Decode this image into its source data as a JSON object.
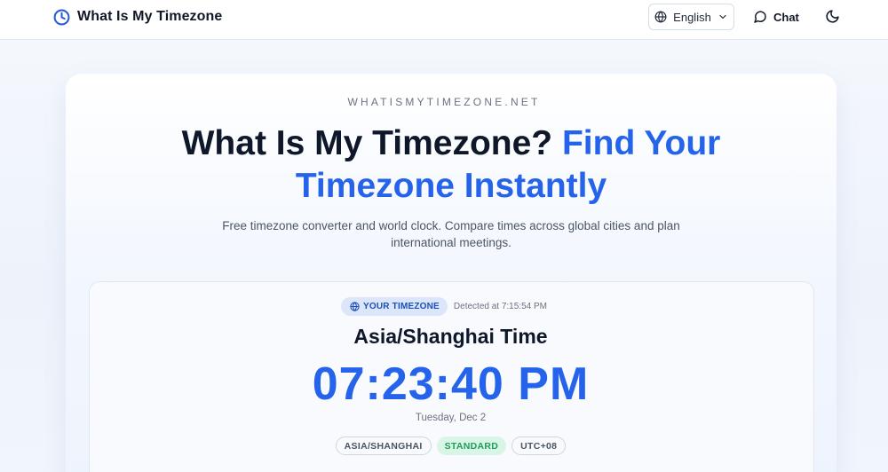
{
  "header": {
    "brand_title": "What Is My Timezone",
    "brand_icon": "clock-icon",
    "language_label": "English",
    "chat_label": "Chat",
    "theme_icon": "moon-icon"
  },
  "hero": {
    "eyebrow": "WHATISMYTIMEZONE.NET",
    "headline_part1": "What Is My Timezone?",
    "headline_part2": "Find Your Timezone Instantly",
    "subtitle": "Free timezone converter and world clock. Compare times across global cities and plan international meetings."
  },
  "timezone_card": {
    "pill_label": "YOUR TIMEZONE",
    "detected_text": "Detected at 7:15:54 PM",
    "zone_title": "Asia/Shanghai Time",
    "clock": "07:23:40 PM",
    "date": "Tuesday, Dec 2",
    "badges": [
      "ASIA/SHANGHAI",
      "STANDARD",
      "UTC+08"
    ]
  },
  "colors": {
    "accent": "#2563eb",
    "heading": "#0f172a",
    "standard_badge_bg": "#d9f5e6",
    "standard_badge_text": "#1f9d5c"
  }
}
